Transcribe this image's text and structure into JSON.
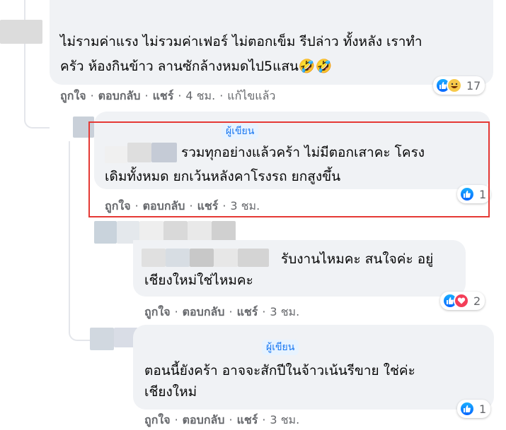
{
  "comments": [
    {
      "id": "c1",
      "text_lines": [
        "ไม่รามค่าแรง ไม่รวมค่าเฟอร์ ไม่ตอกเข็ม รีปล่าว ทั้งหลัง เราทำ",
        "ครัว ห้องกินข้าว ลานซักล้างหมดไป5แสน🤣🤣"
      ],
      "actions": {
        "like": "ถูกใจ",
        "reply": "ตอบกลับ",
        "share": "แชร์",
        "time": "4 ชม.",
        "edited": "แก้ไขแล้ว"
      },
      "reactions": {
        "types": [
          "like-icon",
          "haha-icon"
        ],
        "count": "17"
      }
    },
    {
      "id": "c2",
      "badge": "ผู้เขียน",
      "text_lines": [
        "รวมทุกอย่างแล้วคร้า ไม่มีตอกเสาคะ โครง",
        "เดิมทั้งหมด ยกเว้นหลังคาโรงรถ ยกสูงขึ้น"
      ],
      "actions": {
        "like": "ถูกใจ",
        "reply": "ตอบกลับ",
        "share": "แชร์",
        "time": "3 ชม."
      },
      "reactions": {
        "types": [
          "like-icon"
        ],
        "count": "1"
      },
      "highlighted": true
    },
    {
      "id": "c3",
      "text_lines": [
        "รับงานไหมคะ สนใจค่ะ อยู่",
        "เชียงใหม่ใช่ไหมคะ"
      ],
      "actions": {
        "like": "ถูกใจ",
        "reply": "ตอบกลับ",
        "share": "แชร์",
        "time": "3 ชม."
      },
      "reactions": {
        "types": [
          "like-icon",
          "love-icon"
        ],
        "count": "2"
      }
    },
    {
      "id": "c4",
      "badge": "ผู้เขียน",
      "text_lines": [
        "ตอนนี้ยังคร้า อาจจะสักปีในจ้าวเน้นรีขาย ใช่ค่ะ",
        "เชียงใหม่"
      ],
      "actions": {
        "like": "ถูกใจ",
        "reply": "ตอบกลับ",
        "share": "แชร์",
        "time": "3 ชม."
      },
      "reactions": {
        "types": [
          "like-icon"
        ],
        "count": "1"
      }
    }
  ],
  "colors": {
    "bubble": "#f0f2f5",
    "highlight_border": "#e53935",
    "meta_text": "#65676b",
    "like_blue": "#1877f2",
    "love_red": "#f33e58",
    "haha_yellow": "#f7c94a"
  }
}
